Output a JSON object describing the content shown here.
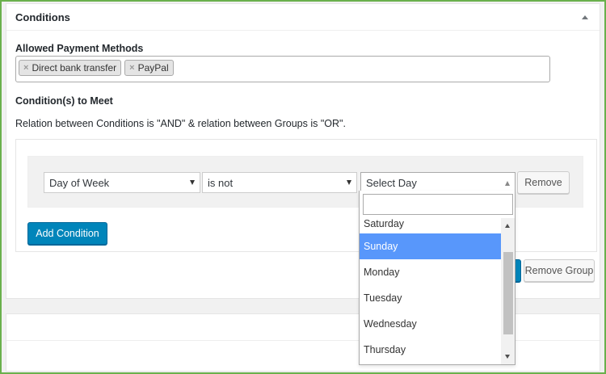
{
  "panel": {
    "title": "Conditions"
  },
  "payment": {
    "label": "Allowed Payment Methods",
    "tags": [
      {
        "remove": "×",
        "label": "Direct bank transfer"
      },
      {
        "remove": "×",
        "label": "PayPal"
      }
    ]
  },
  "conditions": {
    "label": "Condition(s) to Meet",
    "relation_text": "Relation between Conditions is \"AND\" & relation between Groups is \"OR\"."
  },
  "condition_row": {
    "field": "Day of Week",
    "operator": "is not",
    "value_placeholder": "Select Day",
    "remove_label": "Remove"
  },
  "buttons": {
    "add_condition": "Add Condition",
    "remove_group": "Remove Group"
  },
  "dropdown": {
    "search_value": "",
    "options": [
      "Saturday",
      "Sunday",
      "Monday",
      "Tuesday",
      "Wednesday",
      "Thursday"
    ],
    "highlighted": "Sunday"
  },
  "colors": {
    "accent_blue": "#0085ba",
    "highlight": "#5897fb",
    "frame_green": "#6ab04c"
  }
}
